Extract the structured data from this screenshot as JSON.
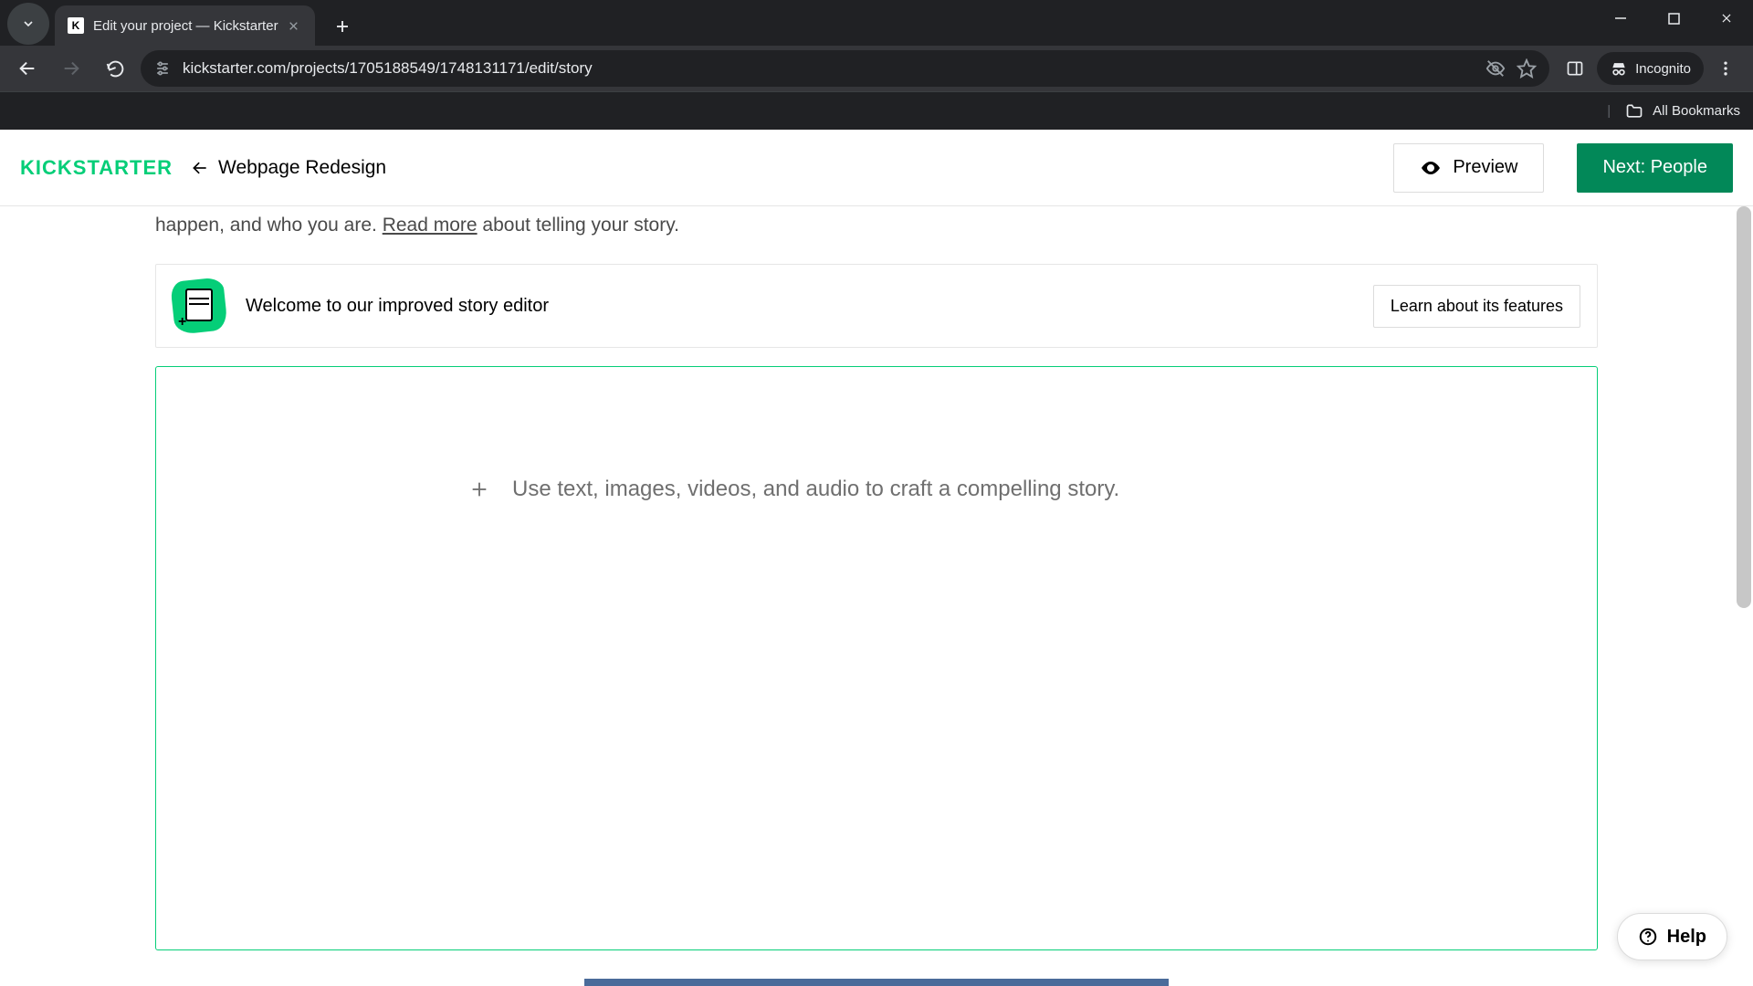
{
  "browser": {
    "tab_title": "Edit your project — Kickstarter",
    "url": "kickstarter.com/projects/1705188549/1748131171/edit/story",
    "incognito_label": "Incognito",
    "bookmarks_label": "All Bookmarks"
  },
  "header": {
    "logo_text": "KICKSTARTER",
    "back_label": "Webpage Redesign",
    "preview_label": "Preview",
    "next_label": "Next: People"
  },
  "intro": {
    "line_prefix": "happen, and who you are. ",
    "read_more": "Read more",
    "line_suffix": " about telling your story."
  },
  "welcome": {
    "text": "Welcome to our improved story editor",
    "button": "Learn about its features"
  },
  "editor": {
    "placeholder": "Use text, images, videos, and audio to craft a compelling story."
  },
  "help": {
    "label": "Help"
  },
  "colors": {
    "ks_green": "#05ce78",
    "ks_dark_green": "#028858"
  }
}
